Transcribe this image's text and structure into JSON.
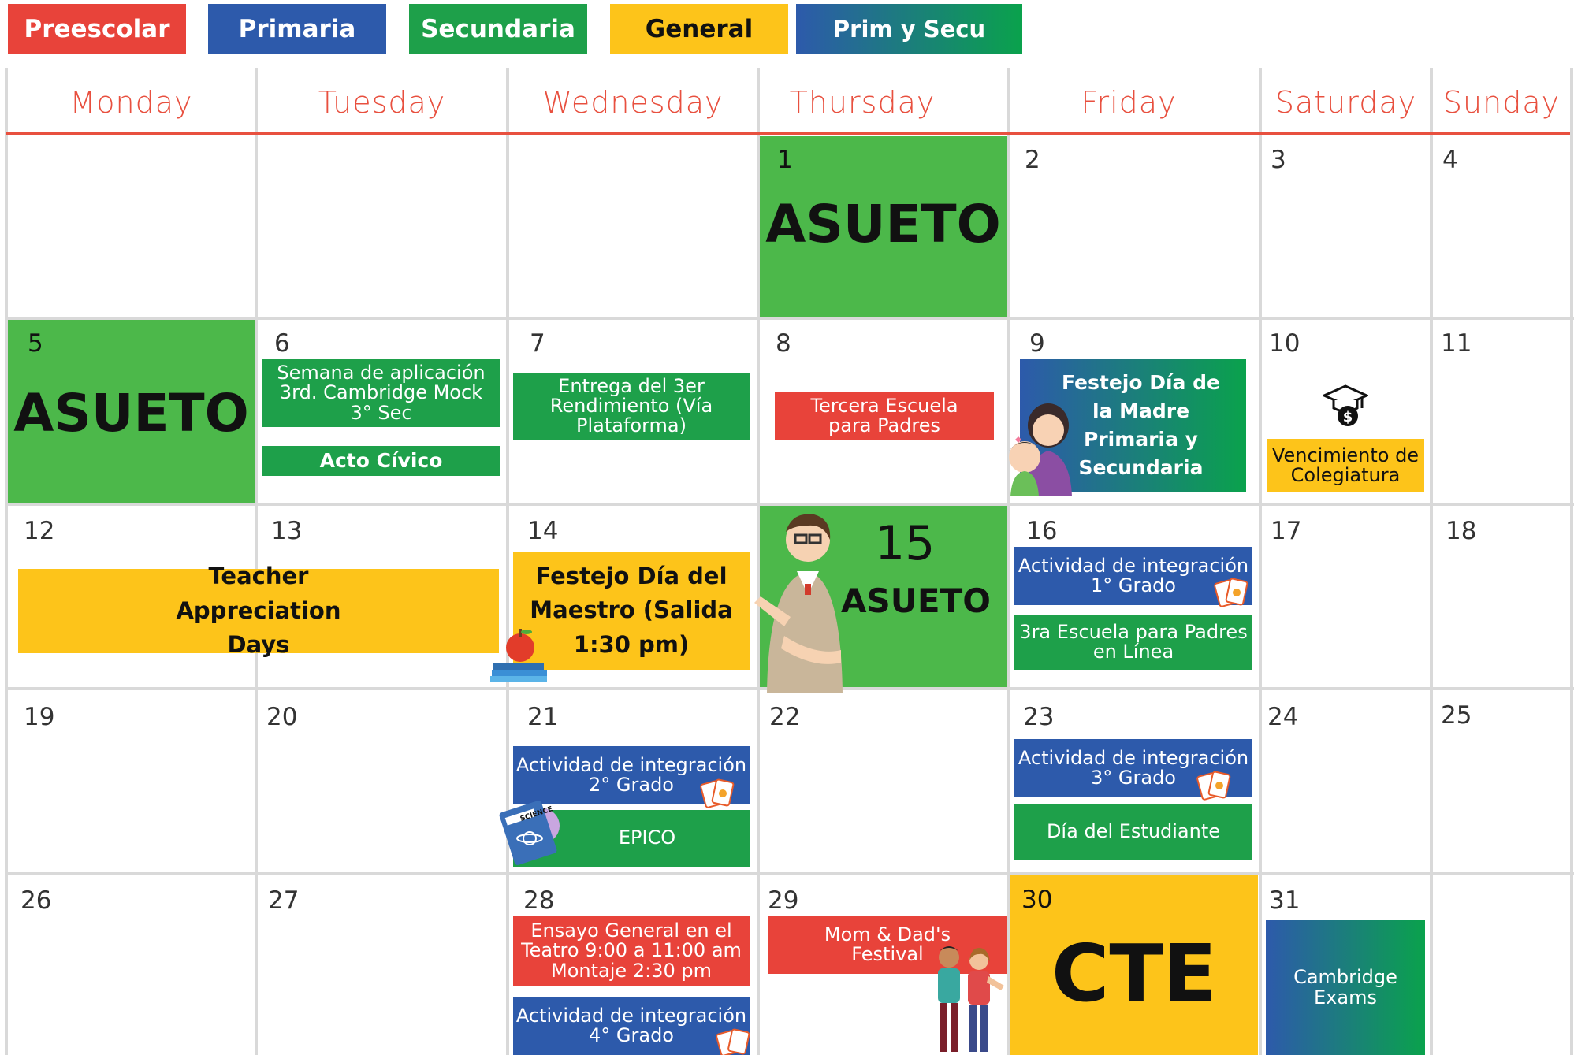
{
  "legend": {
    "preescolar": "Preescolar",
    "primaria": "Primaria",
    "secundaria": "Secundaria",
    "general": "General",
    "prim_secu": "Prim y Secu"
  },
  "colors": {
    "preescolar": "#e8433a",
    "primaria": "#2d5aab",
    "secundaria": "#1ea04a",
    "general": "#fdc41a",
    "header_accent": "#e8503f"
  },
  "days": [
    "Monday",
    "Tuesday",
    "Wednesday",
    "Thursday",
    "Friday",
    "Saturday",
    "Sunday"
  ],
  "dates": [
    "1",
    "2",
    "3",
    "4",
    "5",
    "6",
    "7",
    "8",
    "9",
    "10",
    "11",
    "12",
    "13",
    "14",
    "15",
    "16",
    "17",
    "18",
    "19",
    "20",
    "21",
    "22",
    "23",
    "24",
    "25",
    "26",
    "27",
    "28",
    "29",
    "30",
    "31"
  ],
  "events": {
    "asueto_1": "ASUETO",
    "asueto_5": "ASUETO",
    "asueto_15": "ASUETO",
    "d6_cambridge": "Semana de aplicación 3rd. Cambridge Mock 3° Sec",
    "d6_civico": "Acto Cívico",
    "d7_entrega": "Entrega del 3er Rendimiento (Vía Plataforma)",
    "d8_escuela": "Tercera Escuela para Padres",
    "d9_madre": "Festejo Día de la Madre Primaria y Secundaria",
    "d10_colegiatura": "Vencimiento de Colegiatura",
    "teacher_days": "Teacher Appreciation Days",
    "d14_maestro": "Festejo Día del Maestro (Salida 1:30 pm)",
    "d16_integracion": "Actividad de integración 1° Grado",
    "d16_escuela": "3ra Escuela para Padres en Línea",
    "d21_integracion": "Actividad de integración 2° Grado",
    "d21_epico": "EPICO",
    "d23_integracion": "Actividad de integración 3° Grado",
    "d23_estudiante": "Día del Estudiante",
    "d28_ensayo": "Ensayo General en el Teatro 9:00 a 11:00 am Montaje 2:30 pm",
    "d28_integracion": "Actividad de integración 4° Grado",
    "d29_festival": "Mom & Dad's Festival",
    "d30_cte": "CTE",
    "d31_cambridge": "Cambridge Exams"
  },
  "icons": [
    "graduation-cap-money-icon",
    "mother-child-icon",
    "apple-books-icon",
    "teacher-icon",
    "cards-icon",
    "science-book-icon",
    "parents-icon"
  ]
}
